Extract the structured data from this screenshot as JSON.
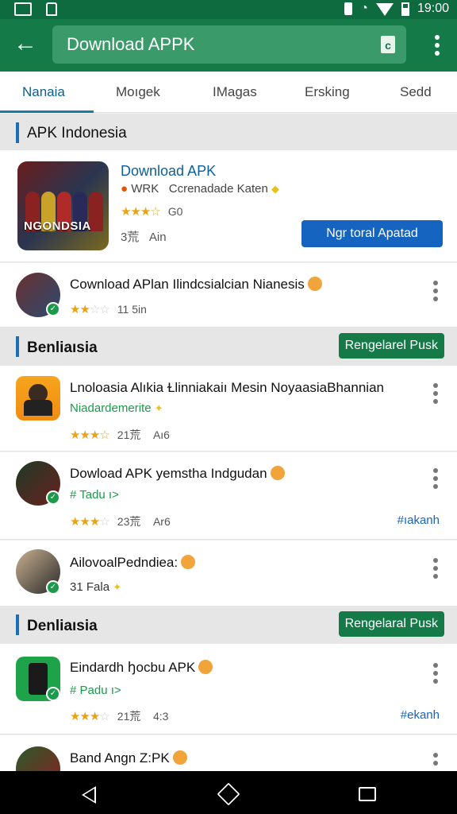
{
  "status": {
    "time": "19:00"
  },
  "search": {
    "query": "Download APPK"
  },
  "tabs": [
    "Nanaia",
    "Moıgek",
    "IMagas",
    "Ersking",
    "Sedd"
  ],
  "section1": {
    "title": "APK Indonesia"
  },
  "featured": {
    "banner_text": "NGONDSIA",
    "title": "Download APK",
    "badge": "WRK",
    "subtitle": "Ccrenadade Katen",
    "rating_text": "G0",
    "size": "3荒",
    "size2": "Ain",
    "button": "Ngr toral Apatad"
  },
  "app1": {
    "title": "Cownload APlan Ilindcsialcian Nianesis",
    "rating_text": "11 5in"
  },
  "section2": {
    "title": "Benliaısia",
    "badge": "Rengelarel Pusk"
  },
  "app2": {
    "title": "Lnoloasia Alıkia Ɫlinniakaiı Mesin NoyaasiaBhannian",
    "dev": "Niadardemerite",
    "rating": "21荒",
    "extra": "Aı6"
  },
  "app3": {
    "title": "Dowload APK yemstha Indgudan",
    "dev": "# Tadu ı>",
    "rating": "23荒",
    "extra": "Ar6",
    "tag": "#ıakanh"
  },
  "app4": {
    "title": "AilovoalPedndiea:",
    "dev": "31 Fala"
  },
  "section3": {
    "title": "Denliaısia",
    "badge": "Rengelaral Pusk"
  },
  "app5": {
    "title": "Eindardh ꜧocbu APK",
    "dev": "# Padu ı>",
    "rating": "21荒",
    "extra": "4:3",
    "tag": "#ekanh"
  },
  "app6": {
    "title": "Band Angn Z:PK"
  },
  "colors": {
    "appbar": "#137a48",
    "accent": "#1565c0",
    "badge": "#137a48"
  }
}
